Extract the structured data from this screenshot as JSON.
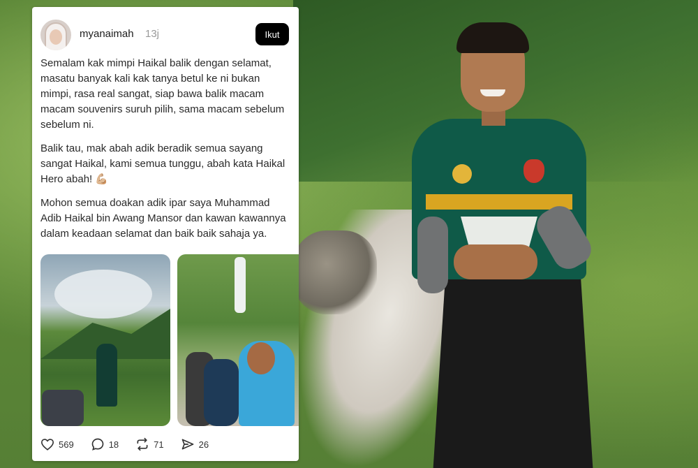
{
  "post": {
    "username": "myanaimah",
    "time_ago": "13j",
    "follow_label": "Ikut",
    "paragraphs": [
      "Semalam kak mimpi Haikal balik dengan selamat, masatu banyak kali kak tanya betul ke ni bukan mimpi, rasa real sangat, siap bawa balik macam macam souvenirs suruh pilih, sama macam sebelum sebelum ni.",
      "Balik tau, mak abah adik beradik semua sayang sangat Haikal, kami semua tunggu, abah kata Haikal Hero abah! 💪🏼",
      "Mohon semua doakan adik ipar saya Muhammad Adib Haikal bin Awang Mansor dan kawan kawannya dalam keadaan selamat dan baik baik sahaja ya."
    ],
    "stats": {
      "likes": "569",
      "comments": "18",
      "reposts": "71",
      "shares": "26"
    }
  },
  "icons": {
    "like": "heart-icon",
    "comment": "comment-bubble-icon",
    "repost": "repost-icon",
    "share": "send-icon"
  },
  "colors": {
    "follow_button_bg": "#000000",
    "card_bg": "#ffffff",
    "muted_text": "#9a9a9a"
  }
}
